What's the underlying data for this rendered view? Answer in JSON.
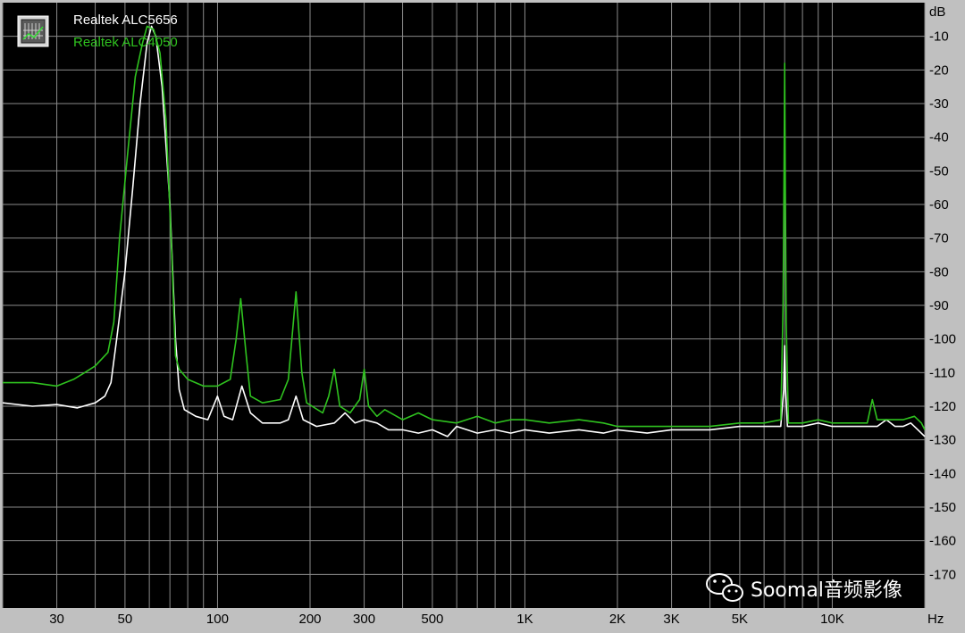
{
  "chart_data": {
    "type": "line",
    "x_scale": "log",
    "xlim": [
      20,
      20000
    ],
    "ylim": [
      -180,
      0
    ],
    "xunit": "Hz",
    "yunit": "dB",
    "grid": true,
    "legend_position": "top-left",
    "x_tick_labels": [
      {
        "v": 30,
        "label": "30"
      },
      {
        "v": 50,
        "label": "50"
      },
      {
        "v": 100,
        "label": "100"
      },
      {
        "v": 200,
        "label": "200"
      },
      {
        "v": 300,
        "label": "300"
      },
      {
        "v": 500,
        "label": "500"
      },
      {
        "v": 1000,
        "label": "1K"
      },
      {
        "v": 2000,
        "label": "2K"
      },
      {
        "v": 3000,
        "label": "3K"
      },
      {
        "v": 5000,
        "label": "5K"
      },
      {
        "v": 10000,
        "label": "10K"
      }
    ],
    "y_ticks": [
      -10,
      -20,
      -30,
      -40,
      -50,
      -60,
      -70,
      -80,
      -90,
      -100,
      -110,
      -120,
      -130,
      -140,
      -150,
      -160,
      -170
    ],
    "series": [
      {
        "name": "Realtek ALC5656",
        "color": "#ffffff",
        "points": [
          [
            20,
            -119
          ],
          [
            25,
            -120
          ],
          [
            30,
            -119.5
          ],
          [
            35,
            -120.5
          ],
          [
            40,
            -119
          ],
          [
            43,
            -117
          ],
          [
            45,
            -113
          ],
          [
            47,
            -100
          ],
          [
            50,
            -80
          ],
          [
            53,
            -55
          ],
          [
            56,
            -30
          ],
          [
            59,
            -12
          ],
          [
            61,
            -7
          ],
          [
            63,
            -10
          ],
          [
            66,
            -25
          ],
          [
            70,
            -60
          ],
          [
            73,
            -100
          ],
          [
            75,
            -115
          ],
          [
            78,
            -121
          ],
          [
            85,
            -123
          ],
          [
            93,
            -124
          ],
          [
            100,
            -117
          ],
          [
            105,
            -123
          ],
          [
            112,
            -124
          ],
          [
            120,
            -114
          ],
          [
            128,
            -122
          ],
          [
            140,
            -125
          ],
          [
            160,
            -125
          ],
          [
            170,
            -124
          ],
          [
            180,
            -117
          ],
          [
            190,
            -124
          ],
          [
            210,
            -126
          ],
          [
            240,
            -125
          ],
          [
            260,
            -122
          ],
          [
            280,
            -125
          ],
          [
            300,
            -124
          ],
          [
            330,
            -125
          ],
          [
            360,
            -127
          ],
          [
            400,
            -127
          ],
          [
            450,
            -128
          ],
          [
            500,
            -127
          ],
          [
            560,
            -129
          ],
          [
            600,
            -126
          ],
          [
            700,
            -128
          ],
          [
            800,
            -127
          ],
          [
            900,
            -128
          ],
          [
            1000,
            -127
          ],
          [
            1200,
            -128
          ],
          [
            1500,
            -127
          ],
          [
            1800,
            -128
          ],
          [
            2000,
            -127
          ],
          [
            2500,
            -128
          ],
          [
            3000,
            -127
          ],
          [
            3500,
            -127
          ],
          [
            4000,
            -127
          ],
          [
            5000,
            -126
          ],
          [
            6000,
            -126
          ],
          [
            6800,
            -126
          ],
          [
            6950,
            -115
          ],
          [
            7000,
            -102
          ],
          [
            7050,
            -115
          ],
          [
            7150,
            -126
          ],
          [
            8000,
            -126
          ],
          [
            9000,
            -125
          ],
          [
            10000,
            -126
          ],
          [
            12000,
            -126
          ],
          [
            14000,
            -126
          ],
          [
            15000,
            -124
          ],
          [
            16000,
            -126
          ],
          [
            17000,
            -126
          ],
          [
            18000,
            -125
          ],
          [
            19000,
            -127
          ],
          [
            20000,
            -129
          ]
        ]
      },
      {
        "name": "Realtek ALC4050",
        "color": "#2fc21f",
        "points": [
          [
            20,
            -113
          ],
          [
            25,
            -113
          ],
          [
            30,
            -114
          ],
          [
            34,
            -112
          ],
          [
            37,
            -110
          ],
          [
            40,
            -108
          ],
          [
            44,
            -104
          ],
          [
            46,
            -95
          ],
          [
            48,
            -70
          ],
          [
            51,
            -45
          ],
          [
            54,
            -22
          ],
          [
            57,
            -12
          ],
          [
            59,
            -7
          ],
          [
            62,
            -8
          ],
          [
            65,
            -15
          ],
          [
            68,
            -35
          ],
          [
            71,
            -75
          ],
          [
            73,
            -105
          ],
          [
            75,
            -109
          ],
          [
            80,
            -112
          ],
          [
            90,
            -114
          ],
          [
            100,
            -114
          ],
          [
            110,
            -112
          ],
          [
            115,
            -100
          ],
          [
            119,
            -88
          ],
          [
            124,
            -105
          ],
          [
            128,
            -117
          ],
          [
            140,
            -119
          ],
          [
            160,
            -118
          ],
          [
            170,
            -112
          ],
          [
            180,
            -86
          ],
          [
            188,
            -110
          ],
          [
            195,
            -119
          ],
          [
            220,
            -122
          ],
          [
            230,
            -117
          ],
          [
            240,
            -109
          ],
          [
            250,
            -120
          ],
          [
            270,
            -122
          ],
          [
            290,
            -118
          ],
          [
            300,
            -109
          ],
          [
            310,
            -120
          ],
          [
            330,
            -123
          ],
          [
            350,
            -121
          ],
          [
            400,
            -124
          ],
          [
            450,
            -122
          ],
          [
            500,
            -124
          ],
          [
            600,
            -125
          ],
          [
            700,
            -123
          ],
          [
            800,
            -125
          ],
          [
            900,
            -124
          ],
          [
            1000,
            -124
          ],
          [
            1200,
            -125
          ],
          [
            1500,
            -124
          ],
          [
            1800,
            -125
          ],
          [
            2000,
            -126
          ],
          [
            2500,
            -126
          ],
          [
            3000,
            -126
          ],
          [
            4000,
            -126
          ],
          [
            5000,
            -125
          ],
          [
            6000,
            -125
          ],
          [
            6800,
            -124
          ],
          [
            6920,
            -90
          ],
          [
            6970,
            -50
          ],
          [
            7000,
            -18
          ],
          [
            7030,
            -50
          ],
          [
            7080,
            -95
          ],
          [
            7200,
            -125
          ],
          [
            8000,
            -125
          ],
          [
            9000,
            -124
          ],
          [
            10000,
            -125
          ],
          [
            12000,
            -125
          ],
          [
            13000,
            -125
          ],
          [
            13500,
            -118
          ],
          [
            14000,
            -124
          ],
          [
            15000,
            -124
          ],
          [
            17000,
            -124
          ],
          [
            18500,
            -123
          ],
          [
            19500,
            -125
          ],
          [
            20000,
            -127
          ]
        ]
      }
    ]
  },
  "watermark": {
    "text": "Soomal音频影像",
    "icon": "wechat-icon"
  }
}
